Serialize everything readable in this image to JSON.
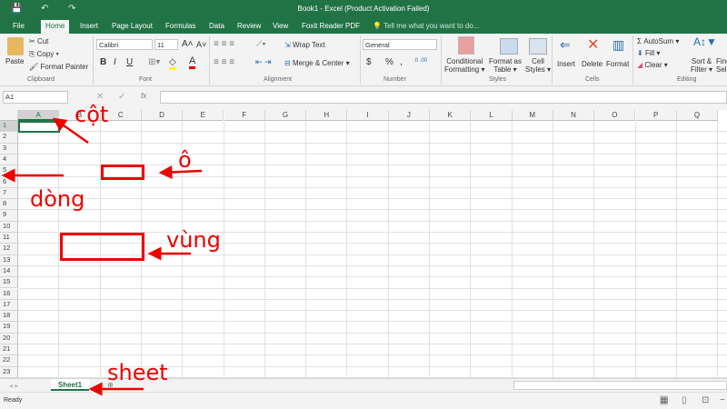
{
  "title": "Book1 - Excel (Product Activation Failed)",
  "tabs": [
    "File",
    "Home",
    "Insert",
    "Page Layout",
    "Formulas",
    "Data",
    "Review",
    "View",
    "Foxit Reader PDF"
  ],
  "tell_me": "Tell me what you want to do...",
  "clipboard": {
    "paste": "Paste",
    "cut": "Cut",
    "copy": "Copy",
    "format_painter": "Format Painter",
    "label": "Clipboard"
  },
  "font": {
    "name": "Calibri",
    "size": "11",
    "bold": "B",
    "italic": "I",
    "underline": "U",
    "label": "Font"
  },
  "alignment": {
    "wrap": "Wrap Text",
    "merge": "Merge & Center",
    "label": "Alignment"
  },
  "number": {
    "format": "General",
    "currency": "$",
    "percent": "%",
    "comma": ",",
    "label": "Number"
  },
  "styles": {
    "conditional": "Conditional",
    "conditional2": "Formatting",
    "format_as": "Format as",
    "table": "Table",
    "cell": "Cell",
    "cell_styles": "Styles",
    "label": "Styles"
  },
  "cells": {
    "insert": "Insert",
    "delete": "Delete",
    "format": "Format",
    "label": "Cells"
  },
  "editing": {
    "autosum": "AutoSum",
    "fill": "Fill",
    "clear": "Clear",
    "sort": "Sort &",
    "filter": "Filter",
    "find": "Find",
    "select": "Sel",
    "label": "Editing"
  },
  "name_box": "A1",
  "fx": "fx",
  "columns": [
    "A",
    "B",
    "C",
    "D",
    "E",
    "F",
    "G",
    "H",
    "I",
    "J",
    "K",
    "L",
    "M",
    "N",
    "O",
    "P",
    "Q"
  ],
  "rows": [
    "1",
    "2",
    "3",
    "4",
    "5",
    "6",
    "7",
    "8",
    "9",
    "10",
    "11",
    "12",
    "13",
    "14",
    "15",
    "16",
    "17",
    "18",
    "19",
    "20",
    "21",
    "22",
    "23"
  ],
  "sheet_tab": "Sheet1",
  "status": "Ready",
  "annotations": {
    "col": "cột",
    "cell": "ô",
    "row": "dòng",
    "range": "vùng",
    "sheet": "sheet"
  },
  "colors": {
    "excel_green": "#217346",
    "annotation_red": "#e00000"
  }
}
